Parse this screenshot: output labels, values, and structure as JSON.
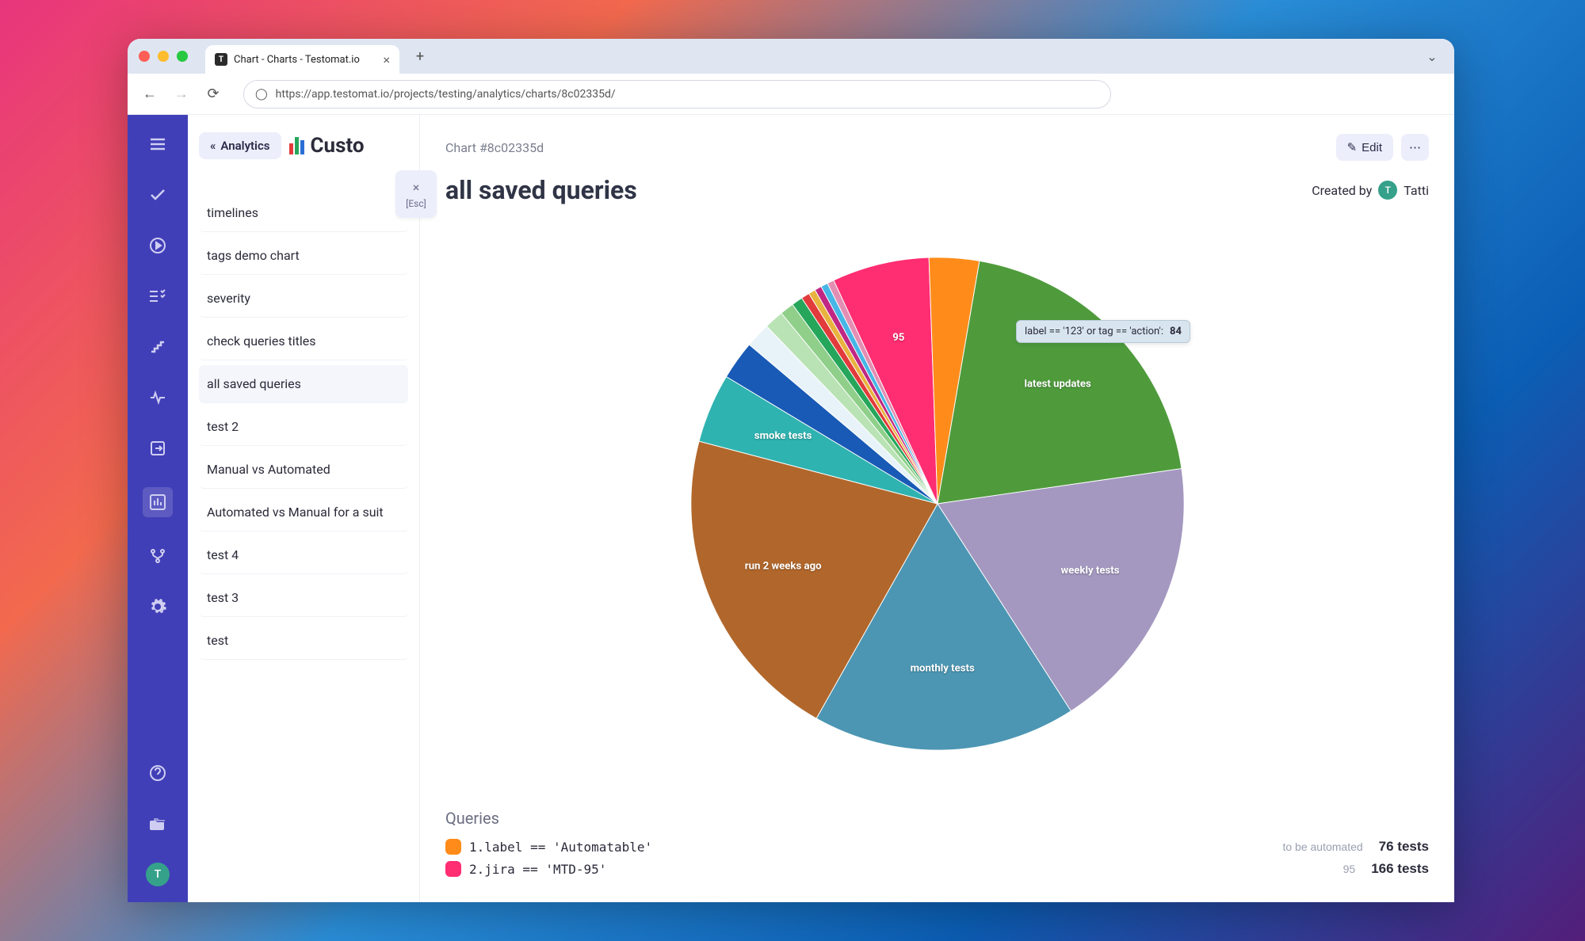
{
  "browser": {
    "tab_title": "Chart - Charts - Testomat.io",
    "url": "https://app.testomat.io/projects/testing/analytics/charts/8c02335d/"
  },
  "rail": {
    "avatar_initial": "T"
  },
  "sidebar": {
    "back_label": "Analytics",
    "section_title": "Custo",
    "close_hint": "[Esc]",
    "items": [
      "timelines",
      "tags demo chart",
      "severity",
      "check queries titles",
      "all saved queries",
      "test 2",
      "Manual vs Automated",
      "Automated vs Manual for a suit",
      "test 4",
      "test 3",
      "test"
    ]
  },
  "main": {
    "chart_id": "Chart #8c02335d",
    "edit_label": "Edit",
    "title": "all saved queries",
    "created_by_prefix": "Created by",
    "created_by_name": "Tatti",
    "created_by_initial": "T",
    "tooltip_label": "label == '123' or tag == 'action':",
    "tooltip_value": "84",
    "queries_heading": "Queries",
    "queries": [
      {
        "n": "1",
        "expr": "label == 'Automatable'",
        "note": "to be automated",
        "count": "76 tests",
        "color": "#ff8c1a"
      },
      {
        "n": "2",
        "expr": "jira == 'MTD-95'",
        "note": "95",
        "count": "166 tests",
        "color": "#ff2d72"
      }
    ]
  },
  "chart_data": {
    "type": "pie",
    "title": "all saved queries",
    "slices": [
      {
        "label": "latest updates",
        "value": 220,
        "color": "#4f9b3c",
        "show": true
      },
      {
        "label": "weekly tests",
        "value": 200,
        "color": "#a498c0",
        "show": true
      },
      {
        "label": "monthly tests",
        "value": 190,
        "color": "#4c96b3",
        "show": true
      },
      {
        "label": "run 2 weeks ago",
        "value": 230,
        "color": "#b1672b",
        "show": true
      },
      {
        "label": "smoke tests",
        "value": 50,
        "color": "#2fb3b0",
        "show": true
      },
      {
        "label": "",
        "value": 28,
        "color": "#185ab5",
        "show": false
      },
      {
        "label": "",
        "value": 18,
        "color": "#e8f3f9",
        "show": false
      },
      {
        "label": "",
        "value": 14,
        "color": "#b9e2b5",
        "show": false
      },
      {
        "label": "",
        "value": 10,
        "color": "#8fcf8a",
        "show": false
      },
      {
        "label": "",
        "value": 8,
        "color": "#26a65b",
        "show": false
      },
      {
        "label": "",
        "value": 6,
        "color": "#e23b3b",
        "show": false
      },
      {
        "label": "",
        "value": 5,
        "color": "#e8b33e",
        "show": false
      },
      {
        "label": "",
        "value": 5,
        "color": "#c02883",
        "show": false
      },
      {
        "label": "",
        "value": 5,
        "color": "#46b6e6",
        "show": false
      },
      {
        "label": "",
        "value": 5,
        "color": "#e28fb3",
        "show": false
      },
      {
        "label": "95",
        "value": 70,
        "color": "#ff2d72",
        "show": true
      },
      {
        "label": "",
        "value": 36,
        "color": "#ff8c1a",
        "show": false
      }
    ]
  }
}
